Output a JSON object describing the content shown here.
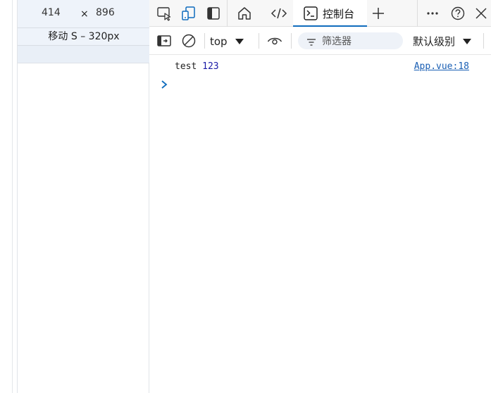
{
  "device": {
    "width_value": "414",
    "times": "×",
    "height_value": "896",
    "preset": "移动 S – 320px"
  },
  "tabs": {
    "console_label": "控制台"
  },
  "toolbar": {
    "context": "top",
    "filter_placeholder": "筛选器",
    "level": "默认级别"
  },
  "console": {
    "log_text": "test ",
    "log_number": "123",
    "log_source": "App.vue:18"
  },
  "colors": {
    "accent": "#0f6cbd",
    "number": "#1a1aa6",
    "link": "#1a5fb4"
  },
  "icons": [
    "inspect-icon",
    "device-emulation-icon",
    "dock-icon",
    "home-icon",
    "elements-icon",
    "console-icon",
    "add-tab-icon",
    "more-icon",
    "help-icon",
    "close-icon",
    "sidebar-icon",
    "clear-console-icon",
    "eye-icon",
    "filter-icon",
    "chevron-down-icon",
    "prompt-icon"
  ]
}
